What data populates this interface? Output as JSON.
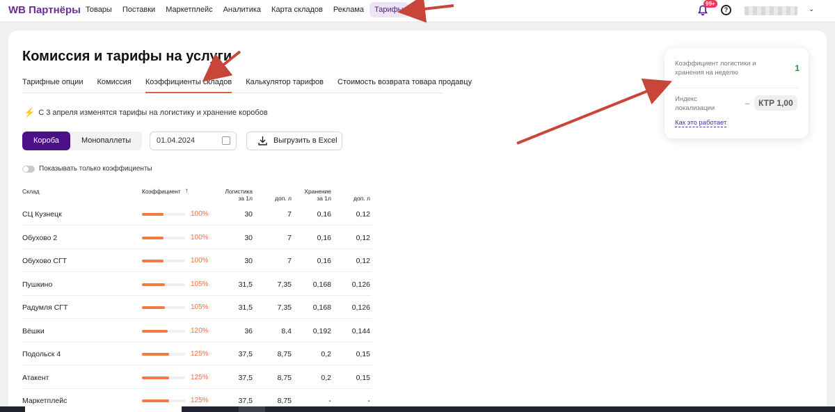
{
  "header": {
    "logo": "WB Партнёры",
    "nav": [
      "Товары",
      "Поставки",
      "Маркетплейс",
      "Аналитика",
      "Карта складов",
      "Реклама",
      "Тарифы"
    ],
    "active_nav": "Тарифы",
    "notification_badge": "99+"
  },
  "page": {
    "title": "Комиссия и тарифы на услуги",
    "tabs": [
      "Тарифные опции",
      "Комиссия",
      "Коэффициенты складов",
      "Калькулятор тарифов",
      "Стоимость возврата товара продавцу"
    ],
    "active_tab": "Коэффициенты складов",
    "notice": "С 3 апреля изменятся тарифы на логистику и хранение коробов"
  },
  "controls": {
    "segment": [
      "Короба",
      "Монопаллеты"
    ],
    "active_segment": "Короба",
    "date_value": "01.04.2024",
    "export_label": "Выгрузить в Excel",
    "toggle_label": "Показывать только коэффициенты",
    "toggle_on": false
  },
  "table": {
    "columns": {
      "warehouse": "Склад",
      "coef": "Коэффициент",
      "logistics": "Логистика",
      "logistics_unit": "за 1л",
      "logistics_extra": "доп. л",
      "storage": "Хранение",
      "storage_unit": "за 1л",
      "storage_extra": "доп. л"
    },
    "rows": [
      {
        "name": "СЦ Кузнецк",
        "coef": "100%",
        "coef_value": 100,
        "log": "30",
        "log_extra": "7",
        "store": "0,16",
        "store_extra": "0,12"
      },
      {
        "name": "Обухово 2",
        "coef": "100%",
        "coef_value": 100,
        "log": "30",
        "log_extra": "7",
        "store": "0,16",
        "store_extra": "0,12"
      },
      {
        "name": "Обухово СГТ",
        "coef": "100%",
        "coef_value": 100,
        "log": "30",
        "log_extra": "7",
        "store": "0,16",
        "store_extra": "0,12"
      },
      {
        "name": "Пушкино",
        "coef": "105%",
        "coef_value": 105,
        "log": "31,5",
        "log_extra": "7,35",
        "store": "0,168",
        "store_extra": "0,126"
      },
      {
        "name": "Радумля СГТ",
        "coef": "105%",
        "coef_value": 105,
        "log": "31,5",
        "log_extra": "7,35",
        "store": "0,168",
        "store_extra": "0,126"
      },
      {
        "name": "Вёшки",
        "coef": "120%",
        "coef_value": 120,
        "log": "36",
        "log_extra": "8,4",
        "store": "0,192",
        "store_extra": "0,144"
      },
      {
        "name": "Подольск 4",
        "coef": "125%",
        "coef_value": 125,
        "log": "37,5",
        "log_extra": "8,75",
        "store": "0,2",
        "store_extra": "0,15"
      },
      {
        "name": "Атакент",
        "coef": "125%",
        "coef_value": 125,
        "log": "37,5",
        "log_extra": "8,75",
        "store": "0,2",
        "store_extra": "0,15"
      },
      {
        "name": "Маркетплейс",
        "coef": "125%",
        "coef_value": 125,
        "log": "37,5",
        "log_extra": "8,75",
        "store": "-",
        "store_extra": "-"
      }
    ]
  },
  "panel": {
    "label1": "Коэффициент логистики и хранения на неделю",
    "value1": "1",
    "label2": "Индекс локализации",
    "dash": "–",
    "ktr": "КТР 1,00",
    "link": "Как это работает"
  },
  "colors": {
    "brand": "#6b2d9a",
    "accent_orange": "#f47a42",
    "active_segment": "#4b0f86",
    "annotation_arrow": "#c8453a"
  }
}
